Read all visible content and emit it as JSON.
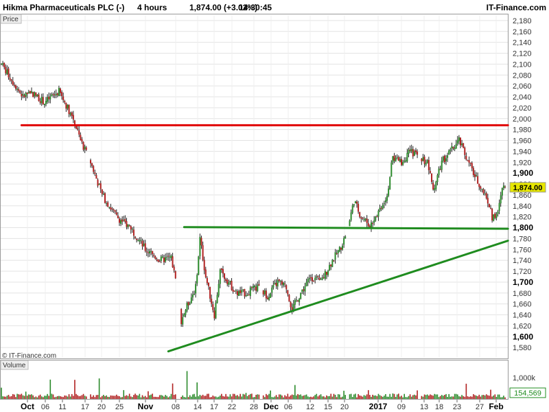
{
  "header": {
    "instrument": "Hikma Pharmaceuticals PLC (-)",
    "timeframe": "4 hours",
    "price_change": "1,874.00 (+3.02%)",
    "time": "14:30:45",
    "brand": "IT-Finance.com"
  },
  "panels": {
    "price_label": "Price",
    "volume_label": "Volume",
    "watermark": "© IT-Finance.com"
  },
  "colors": {
    "up": "#2a8a2a",
    "down": "#b02020",
    "resistance": "#e00000",
    "support": "#1f8c1f",
    "last_tag_bg": "#e6e600",
    "grid": "#e3e3e3"
  },
  "chart_data": {
    "type": "candlestick",
    "title": "",
    "ylim": [
      1560,
      2190
    ],
    "y_ticks": [
      1580,
      1600,
      1620,
      1640,
      1660,
      1680,
      1700,
      1720,
      1740,
      1760,
      1780,
      1800,
      1820,
      1840,
      1860,
      1880,
      1900,
      1920,
      1940,
      1960,
      1980,
      2000,
      2020,
      2040,
      2060,
      2080,
      2100,
      2120,
      2140,
      2160,
      2180
    ],
    "y_tick_labels": [
      "1,580",
      "1,600",
      "1,620",
      "1,640",
      "1,660",
      "1,680",
      "1,700",
      "1,720",
      "1,740",
      "1,760",
      "1,780",
      "1,800",
      "1,820",
      "1,840",
      "1,860",
      "1,880",
      "1,900",
      "1,920",
      "1,940",
      "1,960",
      "1,980",
      "2,000",
      "2,020",
      "2,040",
      "2,060",
      "2,080",
      "2,100",
      "2,120",
      "2,140",
      "2,160",
      "2,180"
    ],
    "y_tick_bold": [
      "1,600",
      "1,700",
      "1,800",
      "1,900"
    ],
    "x_tick_labels": [
      "Oct",
      "06",
      "11",
      "17",
      "20",
      "25",
      "Nov",
      "08",
      "14",
      "17",
      "22",
      "28",
      "Dec",
      "06",
      "12",
      "15",
      "20",
      "2017",
      "09",
      "13",
      "18",
      "23",
      "27",
      "Feb"
    ],
    "x_tick_bold": [
      "Oct",
      "Nov",
      "Dec",
      "2017",
      "Feb"
    ],
    "last_price": 1874,
    "last_price_label": "1,874.00",
    "volume": {
      "tick_label": "1,000k",
      "last_label": "154,569"
    },
    "anchors": [
      [
        0,
        2100
      ],
      [
        10,
        2060
      ],
      [
        15,
        2040
      ],
      [
        20,
        2050
      ],
      [
        30,
        2030
      ],
      [
        40,
        2050
      ],
      [
        50,
        2000
      ],
      [
        55,
        1960
      ],
      [
        62,
        1920
      ],
      [
        70,
        1860
      ],
      [
        80,
        1820
      ],
      [
        90,
        1800
      ],
      [
        100,
        1760
      ],
      [
        110,
        1740
      ],
      [
        118,
        1745
      ],
      [
        122,
        1690
      ],
      [
        125,
        1630
      ],
      [
        128,
        1650
      ],
      [
        135,
        1690
      ],
      [
        138,
        1780
      ],
      [
        142,
        1710
      ],
      [
        148,
        1640
      ],
      [
        152,
        1720
      ],
      [
        158,
        1700
      ],
      [
        163,
        1680
      ],
      [
        170,
        1680
      ],
      [
        178,
        1690
      ],
      [
        185,
        1675
      ],
      [
        192,
        1700
      ],
      [
        198,
        1690
      ],
      [
        202,
        1650
      ],
      [
        208,
        1680
      ],
      [
        215,
        1710
      ],
      [
        222,
        1700
      ],
      [
        230,
        1740
      ],
      [
        235,
        1760
      ],
      [
        240,
        1790
      ],
      [
        245,
        1850
      ],
      [
        250,
        1820
      ],
      [
        256,
        1805
      ],
      [
        262,
        1830
      ],
      [
        268,
        1860
      ],
      [
        272,
        1930
      ],
      [
        278,
        1920
      ],
      [
        284,
        1940
      ],
      [
        290,
        1930
      ],
      [
        296,
        1920
      ],
      [
        300,
        1870
      ],
      [
        306,
        1920
      ],
      [
        312,
        1940
      ],
      [
        318,
        1960
      ],
      [
        322,
        1935
      ],
      [
        328,
        1900
      ],
      [
        334,
        1870
      ],
      [
        338,
        1850
      ],
      [
        341,
        1820
      ],
      [
        345,
        1825
      ],
      [
        348,
        1872
      ],
      [
        350,
        1874
      ]
    ],
    "overlays": [
      {
        "kind": "resistance",
        "x1": 14,
        "y1": 1988,
        "x2": 352,
        "y2": 1988
      },
      {
        "kind": "support",
        "x1": 127,
        "y1": 1801,
        "x2": 352,
        "y2": 1798
      },
      {
        "kind": "trend",
        "x1": 116,
        "y1": 1573,
        "x2": 352,
        "y2": 1776
      }
    ]
  }
}
